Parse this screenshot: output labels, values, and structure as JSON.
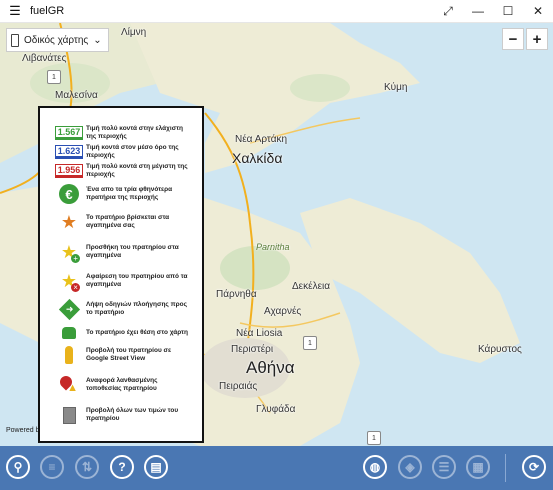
{
  "window": {
    "title": "fuelGR",
    "menu_icon": "hamburger-icon",
    "controls": [
      "expand-icon",
      "minimize-icon",
      "maximize-icon",
      "close-icon"
    ]
  },
  "map_type": {
    "selected": "Οδικός χάρτης"
  },
  "zoom": {
    "minus": "−",
    "plus": "+"
  },
  "map_labels": {
    "limni": "Λίμνη",
    "livanates": "Λιβανάτες",
    "maleviou": "Μαλεσίνα",
    "kymi": "Κύμη",
    "nea_artaki": "Νέα Αρτάκη",
    "chalkida": "Χαλκίδα",
    "parnitha": "Parnitha",
    "parnitha_gr": "Πάρνηθα",
    "dekeleia": "Δεκέλεια",
    "acharnes": "Αχαρνές",
    "nea_liosia": "Νέα Liosia",
    "peristeri": "Περιστέρι",
    "athina": "Αθήνα",
    "piraeus": "Πειραιάς",
    "glyfada": "Γλυφάδα",
    "karystos": "Κάρυστος",
    "powered": "Powered by"
  },
  "legend": {
    "items": [
      {
        "icon": "price-green-box",
        "price": "1.567",
        "text": "Τιμή πολύ κοντά στην ελάχιστη της περιοχής"
      },
      {
        "icon": "price-blue-box",
        "price": "1.623",
        "text": "Τιμή κοντά στον μέσο όρο της περιοχής"
      },
      {
        "icon": "price-red-box",
        "price": "1.956",
        "text": "Τιμή πολύ κοντά στη μέγιστη της περιοχής"
      },
      {
        "icon": "euro-icon",
        "text": "Ένα απο τα τρία φθηνότερα πρατήρια της περιοχής"
      },
      {
        "icon": "favorite-star-icon",
        "text": "Το πρατήριο βρίσκεται στα αγαπημένα σας"
      },
      {
        "icon": "add-favorite-icon",
        "text": "Προσθήκη του πρατηρίου στα αγαπημένα"
      },
      {
        "icon": "remove-favorite-icon",
        "text": "Αφαίρεση του πρατηρίου από τα αγαπημένα"
      },
      {
        "icon": "directions-icon",
        "text": "Λήψη οδηγιών πλοήγησης προς το πρατήριο"
      },
      {
        "icon": "map-position-icon",
        "text": "Το πρατήριο έχει θέση στο χάρτη"
      },
      {
        "icon": "street-view-icon",
        "text": "Προβολή του πρατηρίου σε Google Street View"
      },
      {
        "icon": "report-location-icon",
        "text": "Αναφορά λανθασμένης τοποθεσίας πρατηρίου"
      },
      {
        "icon": "all-prices-icon",
        "text": "Προβολή όλων των τιμών του πρατηρίου"
      }
    ]
  },
  "toolbar": {
    "left": [
      "search-icon",
      "list-icon",
      "sort-icon",
      "help-icon",
      "map-settings-icon"
    ],
    "right": [
      "globe-icon",
      "tag-icon",
      "list-details-icon",
      "notes-icon",
      "refresh-icon"
    ]
  },
  "colors": {
    "toolbar": "#4a77b3",
    "sea": "#cfe6f2",
    "land": "#f3efe4",
    "green": "#3a9d3a",
    "blue": "#2a4fb3",
    "red": "#c62828"
  }
}
